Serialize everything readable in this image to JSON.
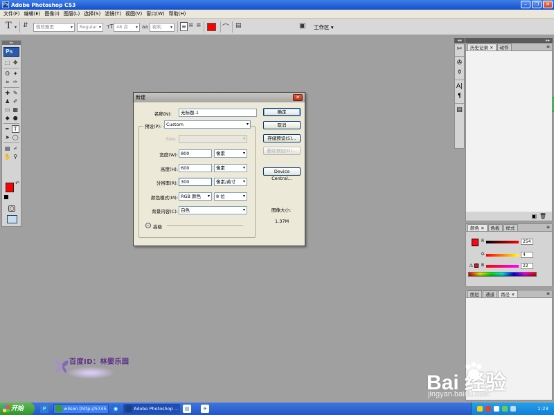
{
  "window": {
    "title": "Adobe Photoshop CS3",
    "app_icon": "Ps"
  },
  "menubar": [
    "文件(F)",
    "编辑(E)",
    "图像(I)",
    "图层(L)",
    "选择(S)",
    "滤镜(T)",
    "视图(V)",
    "窗口(W)",
    "帮助(H)"
  ],
  "options_bar": {
    "tool_glyph": "T",
    "font_family": "微软雅黑",
    "font_style": "Regular",
    "font_size": "48 点",
    "anti_alias_icon": "aa",
    "anti_alias": "锐利",
    "workspace": "工作区",
    "text_color": "#ff0000"
  },
  "toolbox": {
    "logo": "Ps",
    "tools": [
      {
        "name": "marquee-tool",
        "glyph": "⬚"
      },
      {
        "name": "move-tool",
        "glyph": "✥"
      },
      {
        "name": "lasso-tool",
        "glyph": "ʘ"
      },
      {
        "name": "magic-wand-tool",
        "glyph": "✦"
      },
      {
        "name": "crop-tool",
        "glyph": "⌗"
      },
      {
        "name": "slice-tool",
        "glyph": "✑"
      },
      {
        "name": "healing-tool",
        "glyph": "✚"
      },
      {
        "name": "brush-tool",
        "glyph": "✎"
      },
      {
        "name": "stamp-tool",
        "glyph": "♟"
      },
      {
        "name": "history-brush-tool",
        "glyph": "✐"
      },
      {
        "name": "eraser-tool",
        "glyph": "▭"
      },
      {
        "name": "gradient-tool",
        "glyph": "▦"
      },
      {
        "name": "blur-tool",
        "glyph": "◆"
      },
      {
        "name": "dodge-tool",
        "glyph": "●"
      },
      {
        "name": "pen-tool",
        "glyph": "✒"
      },
      {
        "name": "type-tool",
        "glyph": "T"
      },
      {
        "name": "path-select-tool",
        "glyph": "➤"
      },
      {
        "name": "shape-tool",
        "glyph": "◯"
      },
      {
        "name": "notes-tool",
        "glyph": "▤"
      },
      {
        "name": "eyedropper-tool",
        "glyph": "⌿"
      },
      {
        "name": "hand-tool",
        "glyph": "✋"
      },
      {
        "name": "zoom-tool",
        "glyph": "⚲"
      }
    ],
    "foreground_color": "#ff0000",
    "background_color": "#ffffff"
  },
  "panels": {
    "history_tabs": [
      "历史记录",
      "动作"
    ],
    "color_tabs": [
      "颜色",
      "色板",
      "样式"
    ],
    "color": {
      "r_label": "R",
      "g_label": "G",
      "b_label": "B",
      "r": "254",
      "g": "4",
      "b": "22"
    },
    "layers_tabs": [
      "图层",
      "通道",
      "路径"
    ]
  },
  "dialog": {
    "title": "新建",
    "name_label": "名称(N):",
    "name_value": "无标题-1",
    "preset_label": "预设(P):",
    "preset_value": "Custom",
    "size_label": "Size:",
    "width_label": "宽度(W):",
    "width_value": "800",
    "width_unit": "像素",
    "height_label": "高度(H):",
    "height_value": "600",
    "height_unit": "像素",
    "resolution_label": "分辨率(R):",
    "resolution_value": "300",
    "resolution_unit": "像素/英寸",
    "color_mode_label": "颜色模式(M):",
    "color_mode_value": "RGB 颜色",
    "bit_depth_value": "8 位",
    "background_label": "背景内容(C):",
    "background_value": "白色",
    "advanced_label": "高级",
    "ok": "确定",
    "cancel": "取消",
    "save_preset": "存储预设(S)...",
    "delete_preset": "删除预设(D)...",
    "device_central": "Device Central...",
    "image_size_label": "图像大小:",
    "image_size_value": "1.37M"
  },
  "watermarks": {
    "author": "百度ID：林婴乐园",
    "baidu_main": "Bai 经验",
    "baidu_sub": "jingyan.baidu.com"
  },
  "taskbar": {
    "start": "开始",
    "tasks": [
      {
        "label": "wilson [http://5745...",
        "color": "#3c9a3c"
      },
      {
        "label": "Adobe Photoshop ...",
        "color": "#1a3f8a"
      }
    ],
    "clock": "1:23"
  }
}
